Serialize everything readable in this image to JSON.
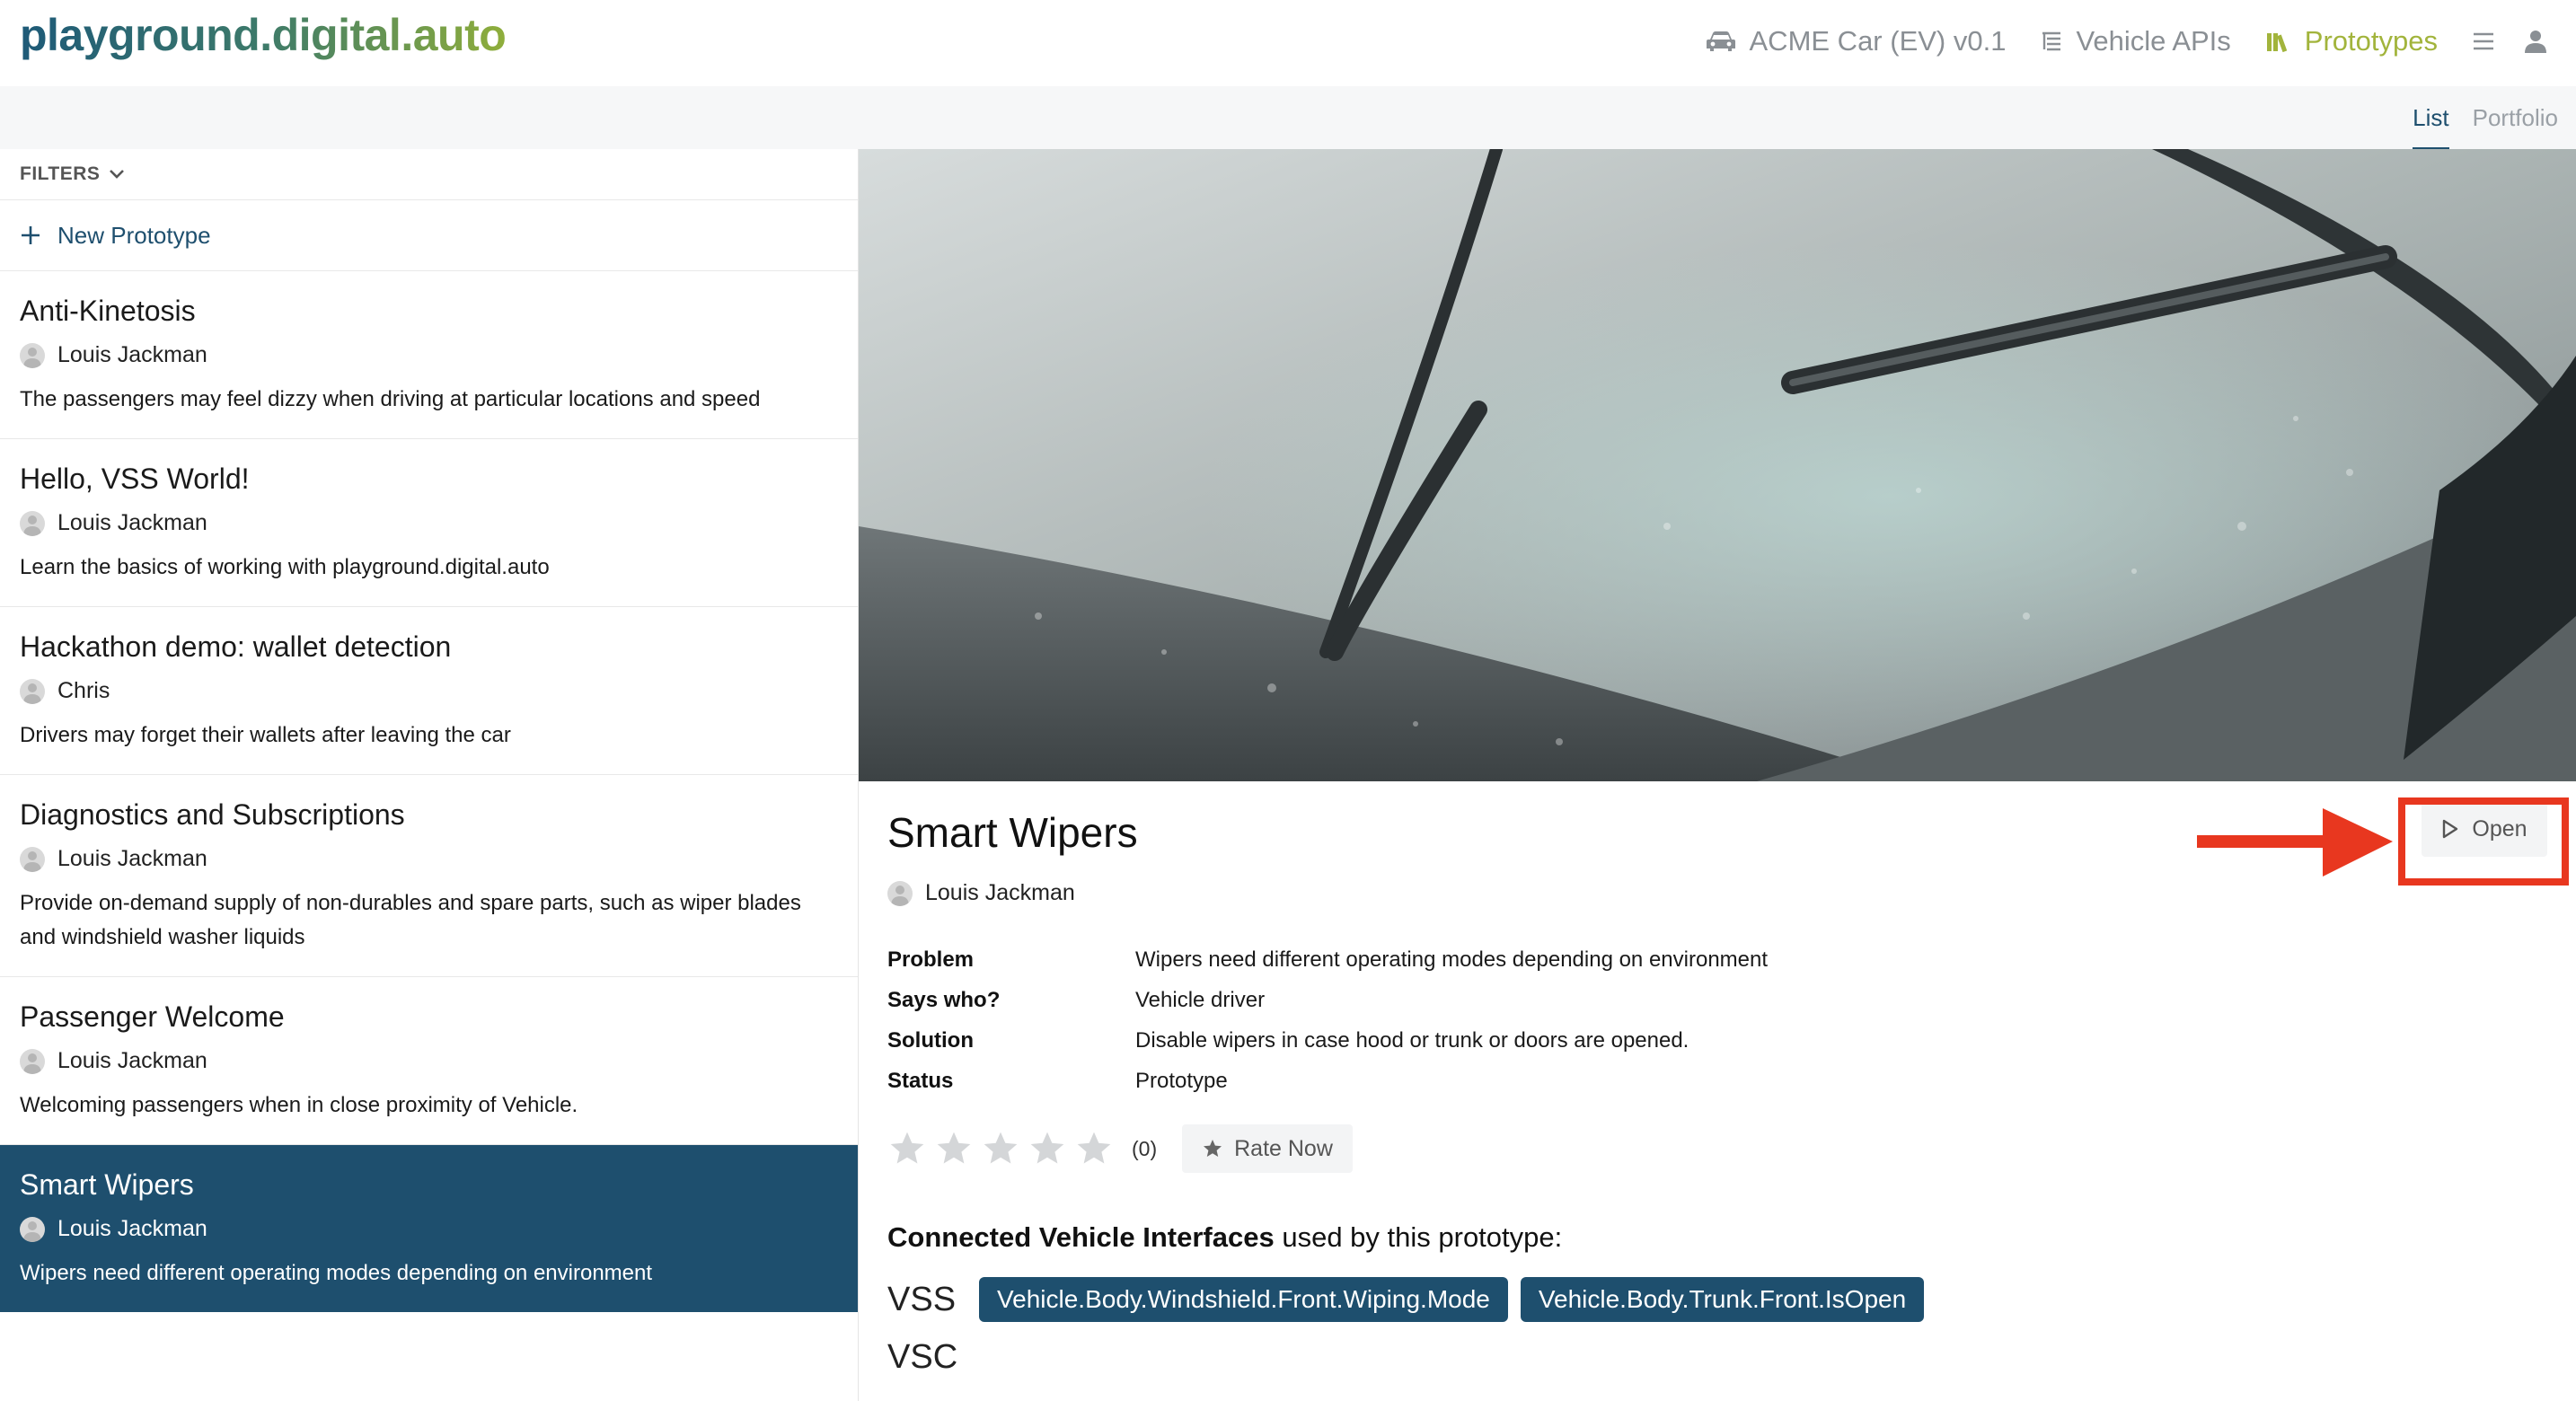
{
  "header": {
    "logo": "playground.digital.auto",
    "nav": {
      "model": "ACME Car (EV) v0.1",
      "apis": "Vehicle APIs",
      "prototypes": "Prototypes"
    }
  },
  "view_tabs": {
    "list": "List",
    "portfolio": "Portfolio"
  },
  "sidebar": {
    "filters_label": "FILTERS",
    "new_prototype_label": "New Prototype",
    "items": [
      {
        "title": "Anti-Kinetosis",
        "author": "Louis Jackman",
        "description": "The passengers may feel dizzy when driving at particular locations and speed"
      },
      {
        "title": "Hello, VSS World!",
        "author": "Louis Jackman",
        "description": "Learn the basics of working with playground.digital.auto"
      },
      {
        "title": "Hackathon demo: wallet detection",
        "author": "Chris",
        "description": "Drivers may forget their wallets after leaving the car"
      },
      {
        "title": "Diagnostics and Subscriptions",
        "author": "Louis Jackman",
        "description": "Provide on-demand supply of non-durables and spare parts, such as wiper blades and windshield washer liquids"
      },
      {
        "title": "Passenger Welcome",
        "author": "Louis Jackman",
        "description": "Welcoming passengers when in close proximity of Vehicle."
      },
      {
        "title": "Smart Wipers",
        "author": "Louis Jackman",
        "description": "Wipers need different operating modes depending on environment"
      }
    ]
  },
  "detail": {
    "title": "Smart Wipers",
    "author": "Louis Jackman",
    "open_label": "Open",
    "info": [
      {
        "key": "Problem",
        "value": "Wipers need different operating modes depending on environment"
      },
      {
        "key": "Says who?",
        "value": "Vehicle driver"
      },
      {
        "key": "Solution",
        "value": "Disable wipers in case hood or trunk or doors are opened."
      },
      {
        "key": "Status",
        "value": "Prototype"
      }
    ],
    "rating_stars": 0,
    "rating_count": "(0)",
    "rate_now_label": "Rate Now",
    "cvi_bold": "Connected Vehicle Interfaces",
    "cvi_rest": " used by this prototype:",
    "vss_label": "VSS",
    "vss_signals": [
      "Vehicle.Body.Windshield.Front.Wiping.Mode",
      "Vehicle.Body.Trunk.Front.IsOpen"
    ],
    "vsc_label": "VSC"
  },
  "colors": {
    "brand_dark": "#1e4f6e",
    "brand_green": "#a2b43c",
    "highlight_red": "#e8371f"
  }
}
